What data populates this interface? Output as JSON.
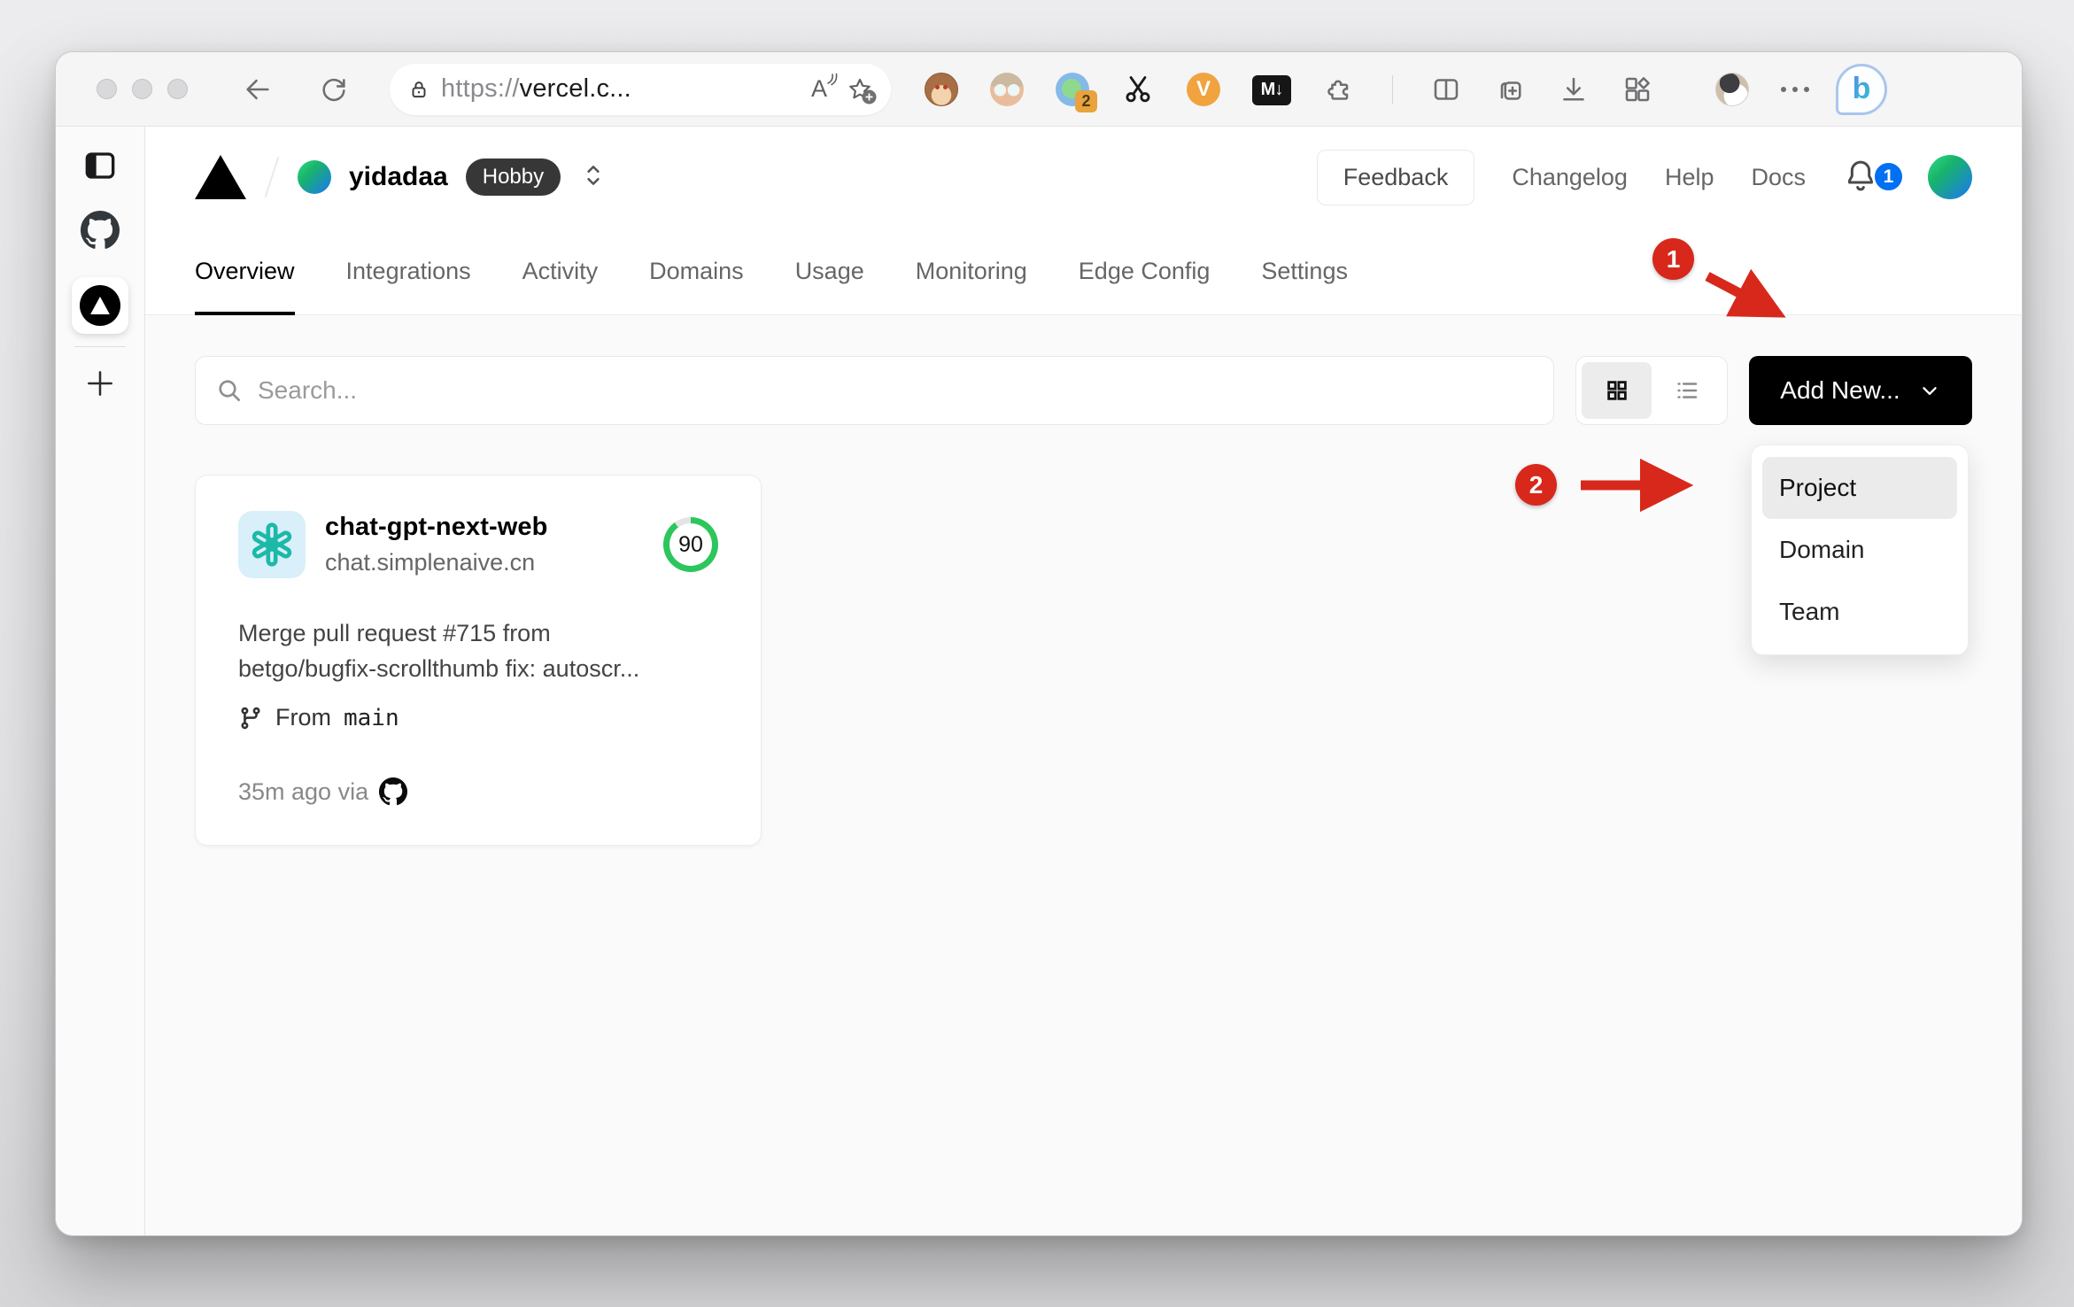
{
  "browser": {
    "url_scheme": "https://",
    "url_host": "vercel.c...",
    "read_aloud_label": "A",
    "extension_badge": "2",
    "v_extension_label": "V",
    "markdown_extension_label": "M↓",
    "bing_label": "b"
  },
  "icons": {
    "toolbar": [
      "back-arrow",
      "refresh",
      "lock",
      "read-aloud",
      "add-favorite",
      "tampermonkey",
      "person-extension",
      "proxy-extension",
      "scissors-extension",
      "v-extension",
      "markdown-extension",
      "extensions-puzzle",
      "split-screen",
      "collections-add",
      "downloads",
      "browser-apps",
      "profile-avatar-cat",
      "more-ellipsis",
      "bing-chat"
    ],
    "vertical_tabs": [
      "tab-panel-toggle",
      "github-favicon",
      "vercel-favicon",
      "new-tab-plus"
    ],
    "site": [
      "vercel-logo-triangle",
      "breadcrumb-slash",
      "team-avatar",
      "team-switcher-chevrons",
      "bell",
      "search-magnifier",
      "grid-view",
      "list-view",
      "chevron-down",
      "openai-logo",
      "git-branch",
      "github-mark"
    ]
  },
  "header": {
    "team_name": "yidadaa",
    "plan_badge": "Hobby",
    "feedback_label": "Feedback",
    "links": [
      "Changelog",
      "Help",
      "Docs"
    ],
    "notification_count": "1"
  },
  "site_tabs": {
    "items": [
      {
        "label": "Overview",
        "active": true
      },
      {
        "label": "Integrations",
        "active": false
      },
      {
        "label": "Activity",
        "active": false
      },
      {
        "label": "Domains",
        "active": false
      },
      {
        "label": "Usage",
        "active": false
      },
      {
        "label": "Monitoring",
        "active": false
      },
      {
        "label": "Edge Config",
        "active": false
      },
      {
        "label": "Settings",
        "active": false
      }
    ]
  },
  "controls": {
    "search_placeholder": "Search...",
    "add_new_label": "Add New..."
  },
  "project_card": {
    "name": "chat-gpt-next-web",
    "domain": "chat.simplenaive.cn",
    "score": "90",
    "commit_line1": "Merge pull request #715 from",
    "commit_line2": "betgo/bugfix-scrollthumb fix: autoscr...",
    "branch_prefix": "From",
    "branch_name": "main",
    "deployed_info": "35m ago via"
  },
  "dropdown": {
    "items": [
      "Project",
      "Domain",
      "Team"
    ],
    "highlighted": "Project"
  },
  "annotations": {
    "step1": "1",
    "step2": "2",
    "color": "#d7281b"
  },
  "colors": {
    "accent_red": "#d7281b",
    "score_green": "#2dc65d",
    "notification_blue": "#0070f3",
    "button_black": "#000000",
    "openai_teal": "#1cb9a8",
    "body_gray": "#fafafa"
  }
}
